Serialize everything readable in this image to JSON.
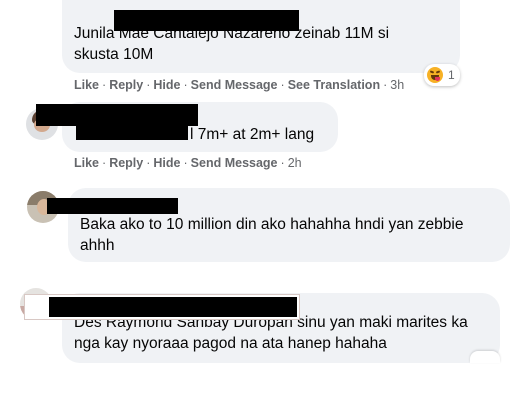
{
  "comments": [
    {
      "name_fragment": "Junila Mae Cantalejo Nazareno",
      "line1": " zeinab 11M si",
      "line2": "skusta 10M",
      "actions": {
        "like": "Like",
        "reply": "Reply",
        "hide": "Hide",
        "send": "Send Message",
        "translate": "See Translation",
        "time": "3h"
      },
      "reaction_count": "1"
    },
    {
      "text": "l 7m+ at 2m+ lang",
      "actions": {
        "like": "Like",
        "reply": "Reply",
        "hide": "Hide",
        "send": "Send Message",
        "time": "2h"
      }
    },
    {
      "line1": "Baka ako to 10 million din ako hahahha hndi yan zebbie",
      "line2": "ahhh"
    },
    {
      "line1_fragment": "Des Raymond Sanbay Duropan",
      "line1": " sinu yan maki marites ka",
      "line2": "nga kay nyoraaa pagod na ata hanep hahaha"
    }
  ],
  "separator": "·",
  "icons": {
    "reaction": "laughing-face-icon"
  },
  "colors": {
    "bubble": "#f0f2f5",
    "action_text": "#65676b",
    "reaction": "#f7b125"
  }
}
